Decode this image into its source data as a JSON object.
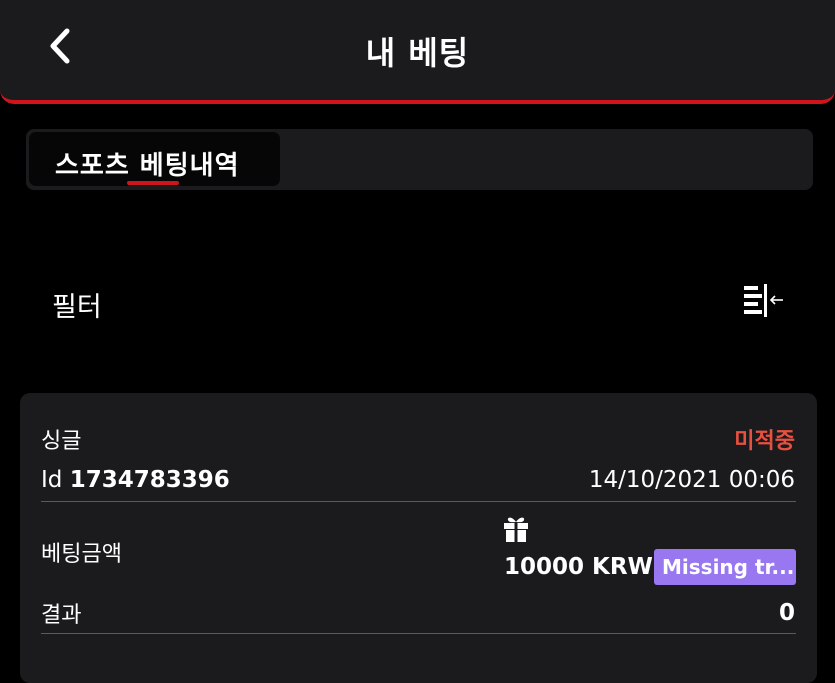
{
  "header": {
    "title": "내 베팅",
    "back_icon": "chevron-left-icon"
  },
  "tabs": [
    {
      "label": "스포츠 베팅내역",
      "active": true
    }
  ],
  "filter": {
    "label": "필터",
    "icon": "filter-collapse-icon"
  },
  "bet": {
    "type": "싱글",
    "status": "미적중",
    "id_prefix": "Id",
    "id": "1734783396",
    "datetime": "14/10/2021 00:06",
    "amount_label": "베팅금액",
    "amount": "10000 KRW",
    "badge": "Missing tr...",
    "result_label": "결과",
    "result": "0"
  },
  "colors": {
    "accent": "#d0141b",
    "status_lost": "#e8503f",
    "badge": "#9877f0",
    "panel": "#1b1b1e"
  }
}
